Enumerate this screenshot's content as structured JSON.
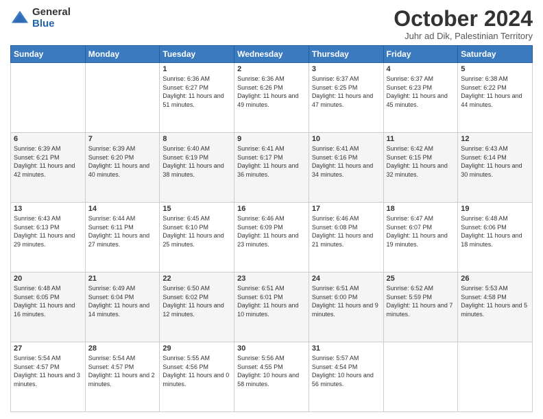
{
  "logo": {
    "general": "General",
    "blue": "Blue"
  },
  "header": {
    "month": "October 2024",
    "location": "Juhr ad Dik, Palestinian Territory"
  },
  "weekdays": [
    "Sunday",
    "Monday",
    "Tuesday",
    "Wednesday",
    "Thursday",
    "Friday",
    "Saturday"
  ],
  "weeks": [
    [
      {
        "day": "",
        "sunrise": "",
        "sunset": "",
        "daylight": ""
      },
      {
        "day": "",
        "sunrise": "",
        "sunset": "",
        "daylight": ""
      },
      {
        "day": "1",
        "sunrise": "Sunrise: 6:36 AM",
        "sunset": "Sunset: 6:27 PM",
        "daylight": "Daylight: 11 hours and 51 minutes."
      },
      {
        "day": "2",
        "sunrise": "Sunrise: 6:36 AM",
        "sunset": "Sunset: 6:26 PM",
        "daylight": "Daylight: 11 hours and 49 minutes."
      },
      {
        "day": "3",
        "sunrise": "Sunrise: 6:37 AM",
        "sunset": "Sunset: 6:25 PM",
        "daylight": "Daylight: 11 hours and 47 minutes."
      },
      {
        "day": "4",
        "sunrise": "Sunrise: 6:37 AM",
        "sunset": "Sunset: 6:23 PM",
        "daylight": "Daylight: 11 hours and 45 minutes."
      },
      {
        "day": "5",
        "sunrise": "Sunrise: 6:38 AM",
        "sunset": "Sunset: 6:22 PM",
        "daylight": "Daylight: 11 hours and 44 minutes."
      }
    ],
    [
      {
        "day": "6",
        "sunrise": "Sunrise: 6:39 AM",
        "sunset": "Sunset: 6:21 PM",
        "daylight": "Daylight: 11 hours and 42 minutes."
      },
      {
        "day": "7",
        "sunrise": "Sunrise: 6:39 AM",
        "sunset": "Sunset: 6:20 PM",
        "daylight": "Daylight: 11 hours and 40 minutes."
      },
      {
        "day": "8",
        "sunrise": "Sunrise: 6:40 AM",
        "sunset": "Sunset: 6:19 PM",
        "daylight": "Daylight: 11 hours and 38 minutes."
      },
      {
        "day": "9",
        "sunrise": "Sunrise: 6:41 AM",
        "sunset": "Sunset: 6:17 PM",
        "daylight": "Daylight: 11 hours and 36 minutes."
      },
      {
        "day": "10",
        "sunrise": "Sunrise: 6:41 AM",
        "sunset": "Sunset: 6:16 PM",
        "daylight": "Daylight: 11 hours and 34 minutes."
      },
      {
        "day": "11",
        "sunrise": "Sunrise: 6:42 AM",
        "sunset": "Sunset: 6:15 PM",
        "daylight": "Daylight: 11 hours and 32 minutes."
      },
      {
        "day": "12",
        "sunrise": "Sunrise: 6:43 AM",
        "sunset": "Sunset: 6:14 PM",
        "daylight": "Daylight: 11 hours and 30 minutes."
      }
    ],
    [
      {
        "day": "13",
        "sunrise": "Sunrise: 6:43 AM",
        "sunset": "Sunset: 6:13 PM",
        "daylight": "Daylight: 11 hours and 29 minutes."
      },
      {
        "day": "14",
        "sunrise": "Sunrise: 6:44 AM",
        "sunset": "Sunset: 6:11 PM",
        "daylight": "Daylight: 11 hours and 27 minutes."
      },
      {
        "day": "15",
        "sunrise": "Sunrise: 6:45 AM",
        "sunset": "Sunset: 6:10 PM",
        "daylight": "Daylight: 11 hours and 25 minutes."
      },
      {
        "day": "16",
        "sunrise": "Sunrise: 6:46 AM",
        "sunset": "Sunset: 6:09 PM",
        "daylight": "Daylight: 11 hours and 23 minutes."
      },
      {
        "day": "17",
        "sunrise": "Sunrise: 6:46 AM",
        "sunset": "Sunset: 6:08 PM",
        "daylight": "Daylight: 11 hours and 21 minutes."
      },
      {
        "day": "18",
        "sunrise": "Sunrise: 6:47 AM",
        "sunset": "Sunset: 6:07 PM",
        "daylight": "Daylight: 11 hours and 19 minutes."
      },
      {
        "day": "19",
        "sunrise": "Sunrise: 6:48 AM",
        "sunset": "Sunset: 6:06 PM",
        "daylight": "Daylight: 11 hours and 18 minutes."
      }
    ],
    [
      {
        "day": "20",
        "sunrise": "Sunrise: 6:48 AM",
        "sunset": "Sunset: 6:05 PM",
        "daylight": "Daylight: 11 hours and 16 minutes."
      },
      {
        "day": "21",
        "sunrise": "Sunrise: 6:49 AM",
        "sunset": "Sunset: 6:04 PM",
        "daylight": "Daylight: 11 hours and 14 minutes."
      },
      {
        "day": "22",
        "sunrise": "Sunrise: 6:50 AM",
        "sunset": "Sunset: 6:02 PM",
        "daylight": "Daylight: 11 hours and 12 minutes."
      },
      {
        "day": "23",
        "sunrise": "Sunrise: 6:51 AM",
        "sunset": "Sunset: 6:01 PM",
        "daylight": "Daylight: 11 hours and 10 minutes."
      },
      {
        "day": "24",
        "sunrise": "Sunrise: 6:51 AM",
        "sunset": "Sunset: 6:00 PM",
        "daylight": "Daylight: 11 hours and 9 minutes."
      },
      {
        "day": "25",
        "sunrise": "Sunrise: 6:52 AM",
        "sunset": "Sunset: 5:59 PM",
        "daylight": "Daylight: 11 hours and 7 minutes."
      },
      {
        "day": "26",
        "sunrise": "Sunrise: 5:53 AM",
        "sunset": "Sunset: 4:58 PM",
        "daylight": "Daylight: 11 hours and 5 minutes."
      }
    ],
    [
      {
        "day": "27",
        "sunrise": "Sunrise: 5:54 AM",
        "sunset": "Sunset: 4:57 PM",
        "daylight": "Daylight: 11 hours and 3 minutes."
      },
      {
        "day": "28",
        "sunrise": "Sunrise: 5:54 AM",
        "sunset": "Sunset: 4:57 PM",
        "daylight": "Daylight: 11 hours and 2 minutes."
      },
      {
        "day": "29",
        "sunrise": "Sunrise: 5:55 AM",
        "sunset": "Sunset: 4:56 PM",
        "daylight": "Daylight: 11 hours and 0 minutes."
      },
      {
        "day": "30",
        "sunrise": "Sunrise: 5:56 AM",
        "sunset": "Sunset: 4:55 PM",
        "daylight": "Daylight: 10 hours and 58 minutes."
      },
      {
        "day": "31",
        "sunrise": "Sunrise: 5:57 AM",
        "sunset": "Sunset: 4:54 PM",
        "daylight": "Daylight: 10 hours and 56 minutes."
      },
      {
        "day": "",
        "sunrise": "",
        "sunset": "",
        "daylight": ""
      },
      {
        "day": "",
        "sunrise": "",
        "sunset": "",
        "daylight": ""
      }
    ]
  ]
}
